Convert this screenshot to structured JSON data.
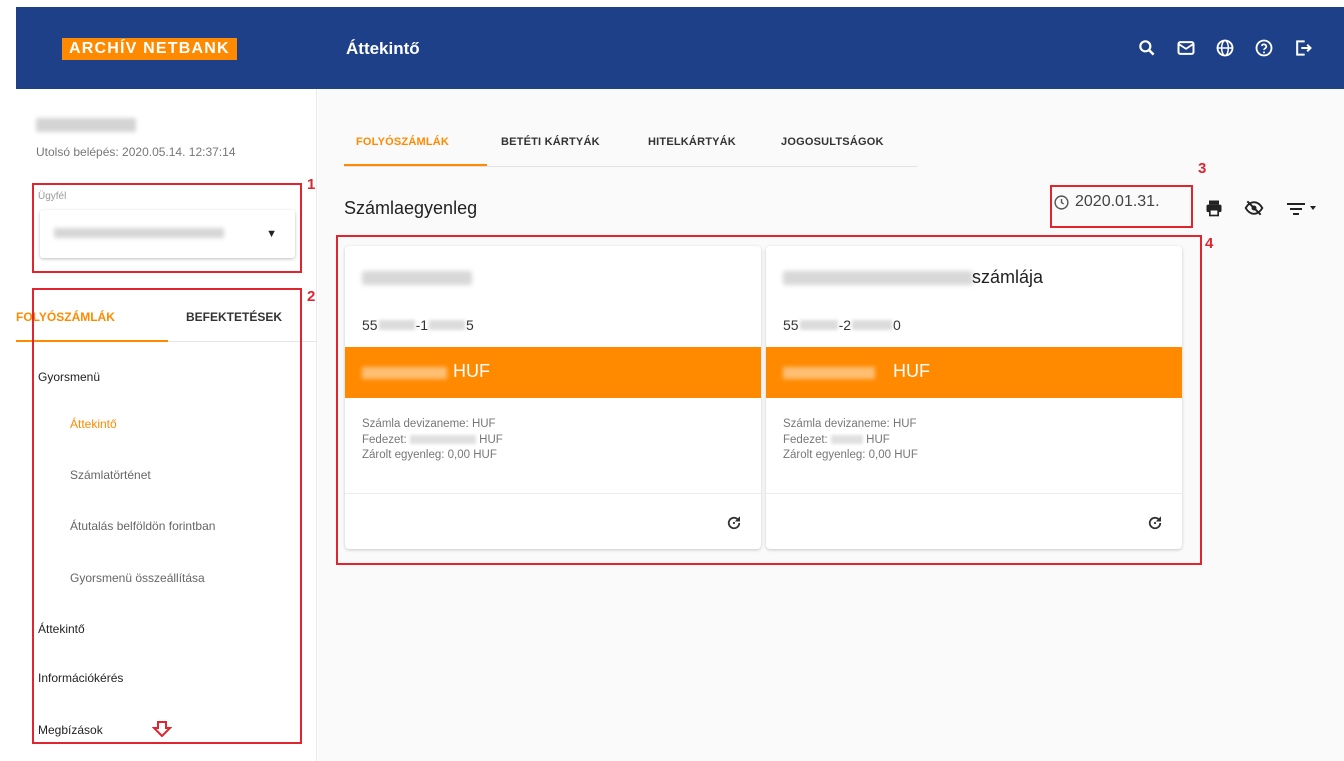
{
  "header": {
    "logo": "ARCHÍV NETBANK",
    "title": "Áttekintő",
    "icons": [
      "search-icon",
      "mail-icon",
      "globe-icon",
      "help-icon",
      "logout-icon"
    ]
  },
  "sidebar": {
    "last_login": "Utolsó belépés: 2020.05.14. 12:37:14",
    "client_label": "Ügyfél",
    "tabs": [
      "FOLYÓSZÁMLÁK",
      "BEFEKTETÉSEK"
    ],
    "nav": [
      {
        "label": "Gyorsmenü"
      },
      {
        "label": "Áttekintő"
      },
      {
        "label": "Számlatörténet"
      },
      {
        "label": "Átutalás belföldön forintban"
      },
      {
        "label": "Gyorsmenü összeállítása"
      },
      {
        "label": "Áttekintő"
      },
      {
        "label": "Információkérés"
      },
      {
        "label": "Megbízások"
      }
    ]
  },
  "main": {
    "tabs": [
      "FOLYÓSZÁMLÁK",
      "BETÉTI KÁRTYÁK",
      "HITELKÁRTYÁK",
      "JOGOSULTSÁGOK"
    ],
    "section_title": "Számlaegyenleg",
    "date": "2020.01.31.",
    "cards": [
      {
        "name_suffix": "",
        "acct_prefix": "55",
        "acct_mid": "-1",
        "acct_end": "5",
        "currency": "HUF",
        "details": {
          "devizanem": "Számla devizaneme: HUF",
          "fedezet_label": "Fedezet:",
          "fedezet_cur": "HUF",
          "zarolt": "Zárolt egyenleg: 0,00 HUF"
        }
      },
      {
        "name_suffix": "számlája",
        "acct_prefix": "55",
        "acct_mid": "-2",
        "acct_end": "0",
        "currency": "HUF",
        "details": {
          "devizanem": "Számla devizaneme: HUF",
          "fedezet_label": "Fedezet:",
          "fedezet_cur": "HUF",
          "zarolt": "Zárolt egyenleg: 0,00 HUF"
        }
      }
    ]
  },
  "annotations": [
    "1",
    "2",
    "3",
    "4"
  ],
  "colors": {
    "header": "#1d4089",
    "accent": "#ff8a00",
    "annotation": "#e0252e"
  }
}
